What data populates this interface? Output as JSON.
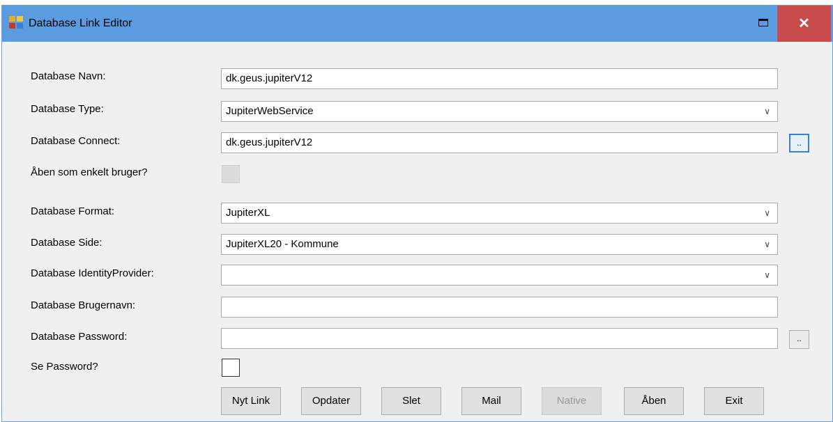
{
  "window": {
    "title": "Database Link Editor",
    "close_glyph": "✕"
  },
  "form": {
    "database_name": {
      "label": "Database Navn:",
      "value": "dk.geus.jupiterV12"
    },
    "database_type": {
      "label": "Database Type:",
      "value": "JupiterWebService"
    },
    "database_connect": {
      "label": "Database Connect:",
      "value": "dk.geus.jupiterV12",
      "browse_label": ".."
    },
    "single_user": {
      "label": "Åben som enkelt bruger?",
      "checked": false,
      "enabled": false
    },
    "database_format": {
      "label": "Database Format:",
      "value": "JupiterXL"
    },
    "database_side": {
      "label": "Database Side:",
      "value": "JupiterXL20 - Kommune"
    },
    "identity_provider": {
      "label": "Database IdentityProvider:",
      "value": ""
    },
    "username": {
      "label": "Database Brugernavn:",
      "value": ""
    },
    "password": {
      "label": "Database Password:",
      "value": "",
      "browse_label": ".."
    },
    "show_password": {
      "label": "Se Password?",
      "checked": false
    }
  },
  "buttons": {
    "new_link": "Nyt Link",
    "update": "Opdater",
    "delete": "Slet",
    "mail": "Mail",
    "native": "Native",
    "open": "Åben",
    "exit": "Exit"
  },
  "icons": {
    "combo_arrow": "chevron-down-icon",
    "app_icon": "database-link-app-icon"
  },
  "colors": {
    "titlebar": "#5b9be0",
    "close_button": "#c94c4c",
    "background": "#f0f0f0"
  }
}
